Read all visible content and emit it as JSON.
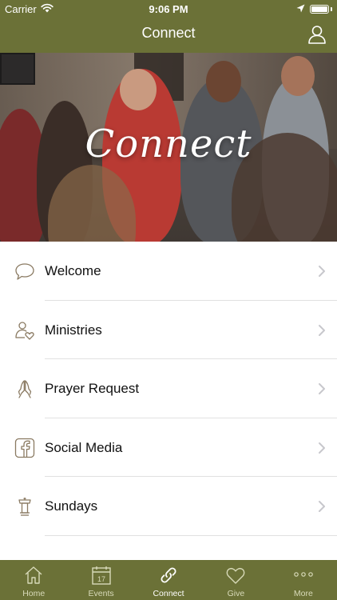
{
  "status_bar": {
    "carrier": "Carrier",
    "time": "9:06 PM"
  },
  "nav": {
    "title": "Connect"
  },
  "hero": {
    "overlay_text": "Connect"
  },
  "menu": {
    "items": [
      {
        "label": "Welcome",
        "icon": "speech-bubble-icon"
      },
      {
        "label": "Ministries",
        "icon": "person-heart-icon"
      },
      {
        "label": "Prayer Request",
        "icon": "praying-hands-icon"
      },
      {
        "label": "Social Media",
        "icon": "facebook-icon"
      },
      {
        "label": "Sundays",
        "icon": "pulpit-icon"
      }
    ]
  },
  "tabbar": {
    "tabs": [
      {
        "label": "Home",
        "icon": "home-icon",
        "active": false
      },
      {
        "label": "Events",
        "icon": "calendar-icon",
        "active": false,
        "calendar_day": "17"
      },
      {
        "label": "Connect",
        "icon": "link-icon",
        "active": true
      },
      {
        "label": "Give",
        "icon": "heart-icon",
        "active": false
      },
      {
        "label": "More",
        "icon": "more-dots-icon",
        "active": false
      }
    ]
  },
  "colors": {
    "brand": "#6b7137",
    "tab_inactive": "#d8dab9",
    "icon_outline": "#8a7a62",
    "chevron": "#c7c7cc"
  }
}
